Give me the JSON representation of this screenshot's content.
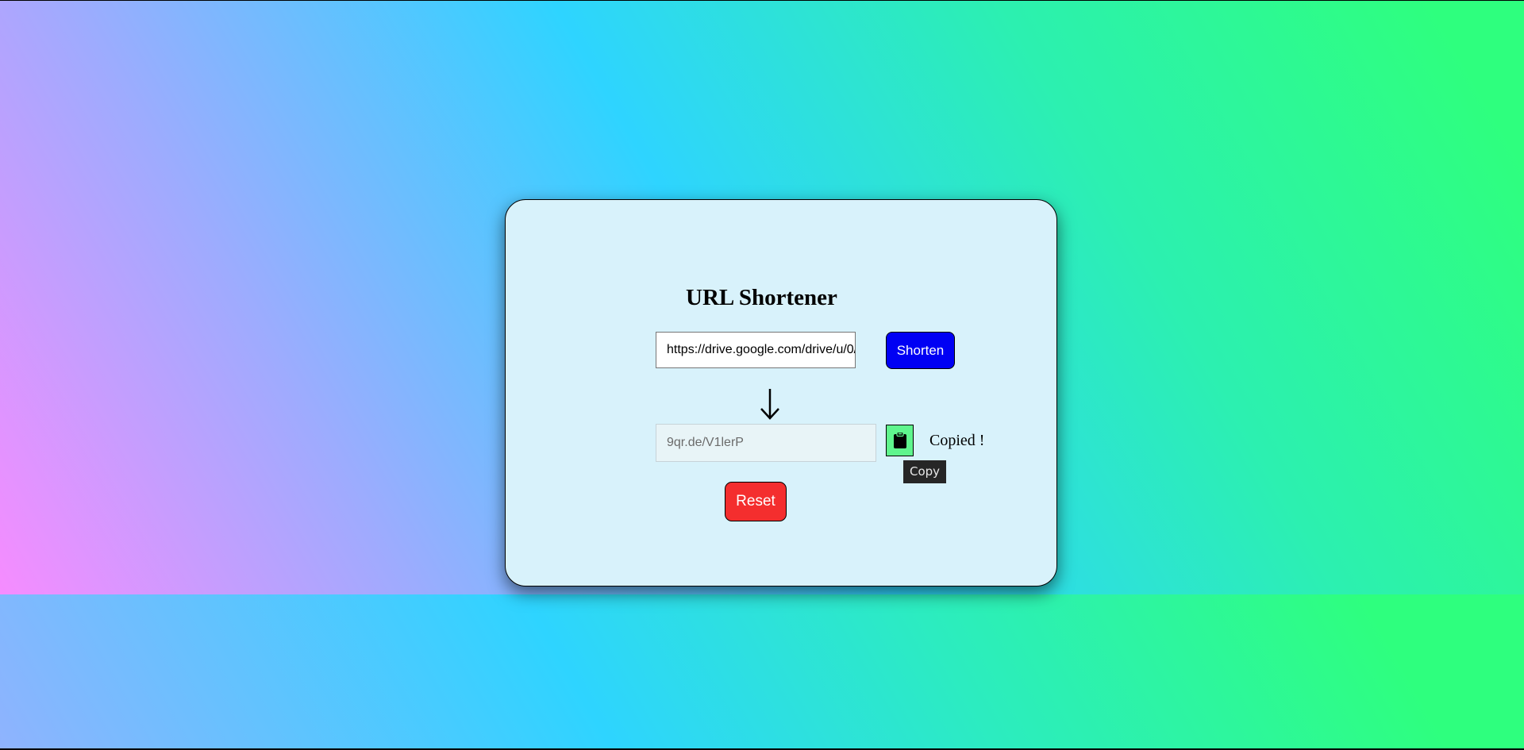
{
  "app": {
    "title": "URL Shortener"
  },
  "form": {
    "long_url_value": "https://drive.google.com/drive/u/0/",
    "shorten_label": "Shorten",
    "short_url_value": "9qr.de/V1lerP",
    "copy_tooltip": "Copy",
    "copied_status": "Copied !",
    "reset_label": "Reset"
  },
  "icons": {
    "arrow": "arrow-down-icon",
    "copy": "clipboard-icon"
  },
  "colors": {
    "shorten_button": "#0000f4",
    "copy_button": "#5ff58d",
    "reset_button": "#f42e2e",
    "card_background": "#d8f2fb"
  }
}
